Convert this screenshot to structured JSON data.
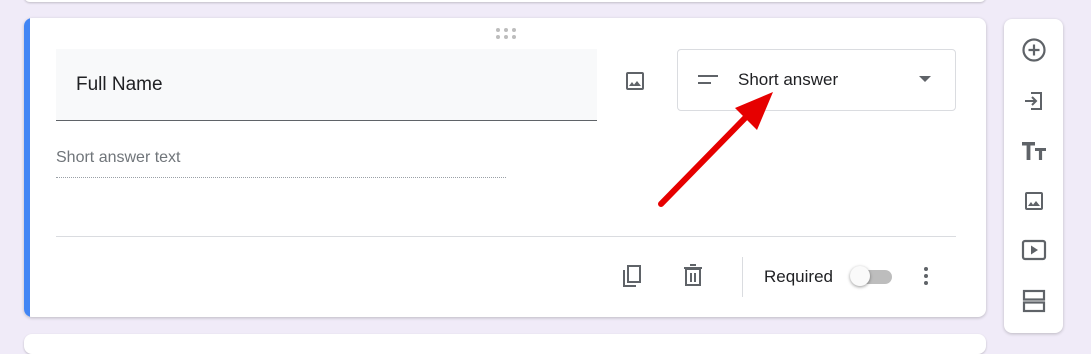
{
  "question": {
    "title": "Full Name",
    "type_selected": "Short answer",
    "answer_placeholder": "Short answer text",
    "required_label": "Required",
    "required_on": false
  },
  "colors": {
    "accent": "#4285f4",
    "background": "#f0ebf8",
    "annotation_arrow": "#e60000"
  },
  "icons": {
    "question_image": "image-icon",
    "type_lines": "short-answer-icon",
    "type_caret": "dropdown-caret-icon",
    "duplicate": "copy-icon",
    "delete": "trash-icon",
    "more": "more-vert-icon",
    "toolbar": [
      "add-question-icon",
      "import-questions-icon",
      "add-title-icon",
      "add-image-icon",
      "add-video-icon",
      "add-section-icon"
    ]
  }
}
